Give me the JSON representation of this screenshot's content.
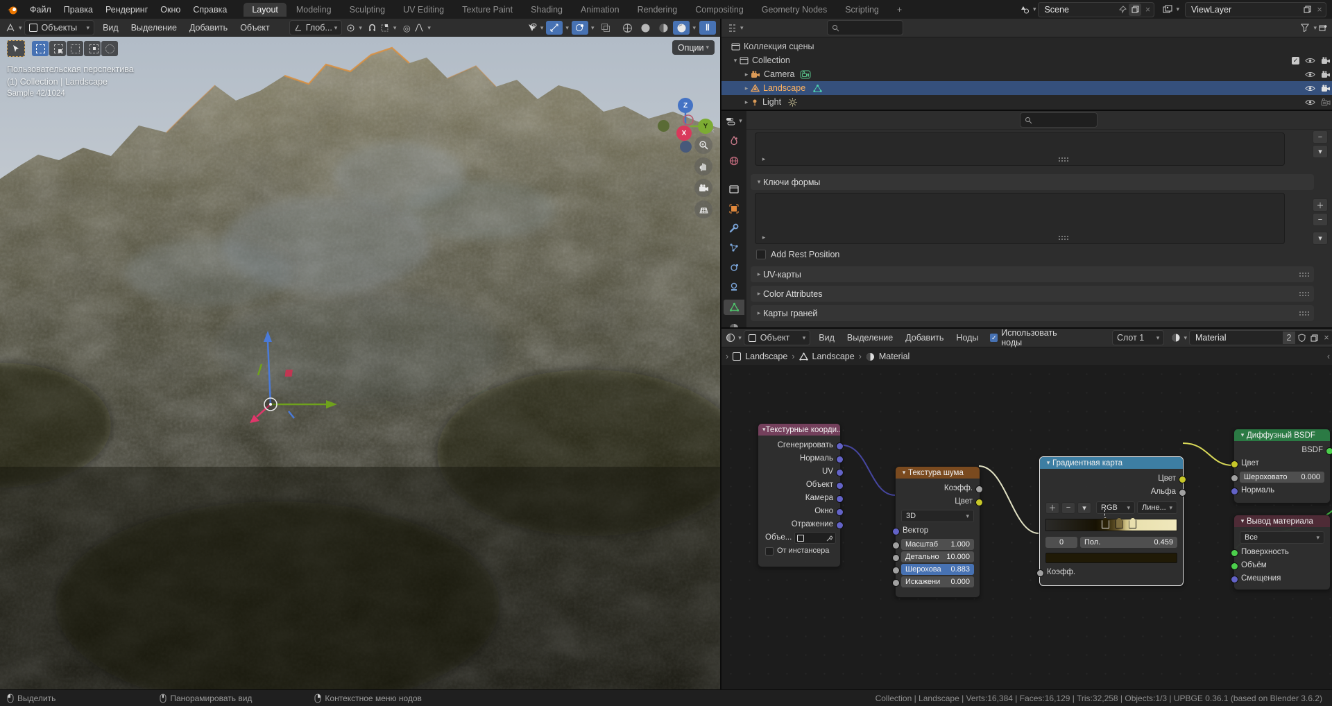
{
  "topbar": {
    "menus": [
      "Файл",
      "Правка",
      "Рендеринг",
      "Окно",
      "Справка"
    ],
    "tabs": [
      "Layout",
      "Modeling",
      "Sculpting",
      "UV Editing",
      "Texture Paint",
      "Shading",
      "Animation",
      "Rendering",
      "Compositing",
      "Geometry Nodes",
      "Scripting"
    ],
    "active_tab": "Layout",
    "add_tab": "+",
    "scene_name": "Scene",
    "viewlayer_name": "ViewLayer"
  },
  "viewport": {
    "header": {
      "mode": "Объекты",
      "menus": [
        "Вид",
        "Выделение",
        "Добавить",
        "Объект"
      ],
      "orientation": "Глоб...",
      "options_label": "Опции"
    },
    "overlay": {
      "line1": "Пользовательская перспектива",
      "line2": "(1) Collection | Landscape",
      "line3": "Sample 42/1024"
    },
    "axis": {
      "x": "X",
      "y": "Y",
      "z": "Z"
    }
  },
  "outliner": {
    "root": "Коллекция сцены",
    "items": [
      {
        "name": "Collection"
      },
      {
        "name": "Camera"
      },
      {
        "name": "Landscape"
      },
      {
        "name": "Light"
      }
    ]
  },
  "properties": {
    "shape_keys_label": "Ключи формы",
    "add_rest_label": "Add Rest Position",
    "panels": [
      "UV-карты",
      "Color Attributes",
      "Карты граней"
    ]
  },
  "node_editor": {
    "header": {
      "mode": "Объект",
      "menus": [
        "Вид",
        "Выделение",
        "Добавить",
        "Ноды"
      ],
      "use_nodes": "Использовать ноды",
      "slot": "Слот 1",
      "material": "Material",
      "users": "2"
    },
    "breadcrumb": [
      "Landscape",
      "Landscape",
      "Material"
    ],
    "nodes": {
      "tex_coord": {
        "title": "Текстурные коорди...",
        "outputs": [
          "Сгенерировать",
          "Нормаль",
          "UV",
          "Объект",
          "Камера",
          "Окно",
          "Отражение"
        ],
        "object_label": "Объе...",
        "instancer_label": "От инстансера"
      },
      "noise": {
        "title": "Текстура шума",
        "outputs": [
          "Коэфф.",
          "Цвет"
        ],
        "dimensions": "3D",
        "vector_label": "Вектор",
        "params": [
          {
            "label": "Масштаб",
            "value": "1.000"
          },
          {
            "label": "Детально",
            "value": "10.000"
          },
          {
            "label": "Шерохова",
            "value": "0.883"
          },
          {
            "label": "Искажени",
            "value": "0.000"
          }
        ]
      },
      "ramp": {
        "title": "Градиентная карта",
        "outputs": [
          "Цвет",
          "Альфа"
        ],
        "mode": "RGB",
        "interpolation": "Лине...",
        "index": "0",
        "pos_label": "Пол.",
        "pos_value": "0.459",
        "input_label": "Коэфф."
      },
      "diffuse": {
        "title": "Диффузный BSDF",
        "output": "BSDF",
        "color_label": "Цвет",
        "rough_label": "Шероховато",
        "rough_value": "0.000",
        "normal_label": "Нормаль"
      },
      "output": {
        "title": "Вывод материала",
        "target": "Все",
        "inputs": [
          "Поверхность",
          "Объём",
          "Смещения"
        ]
      }
    }
  },
  "status_bar": {
    "left": "Выделить",
    "middle": "Панорамировать вид",
    "right_hint": "Контекстное меню нодов",
    "info": "Collection | Landscape | Verts:16,384 | Faces:16,129 | Tris:32,258 | Objects:1/3 | UPBGE 0.36.1 (based on Blender 3.6.2)"
  },
  "colors": {
    "accent": "#4772b3",
    "selection_row": "#35507c",
    "active_object_text": "#ffb25f",
    "node_header_input": "#74405c",
    "node_header_texture": "#7a4a1f",
    "node_header_converter": "#3d7ea3",
    "node_header_shader": "#2b7a44",
    "node_header_output": "#4e2b36",
    "socket_vector": "#6363c7",
    "socket_color": "#c7c729",
    "socket_float": "#a1a1a1",
    "socket_shader": "#4ccf4c",
    "axis_x": "#e0365c",
    "axis_y": "#7cab33",
    "axis_z": "#4573c4"
  }
}
